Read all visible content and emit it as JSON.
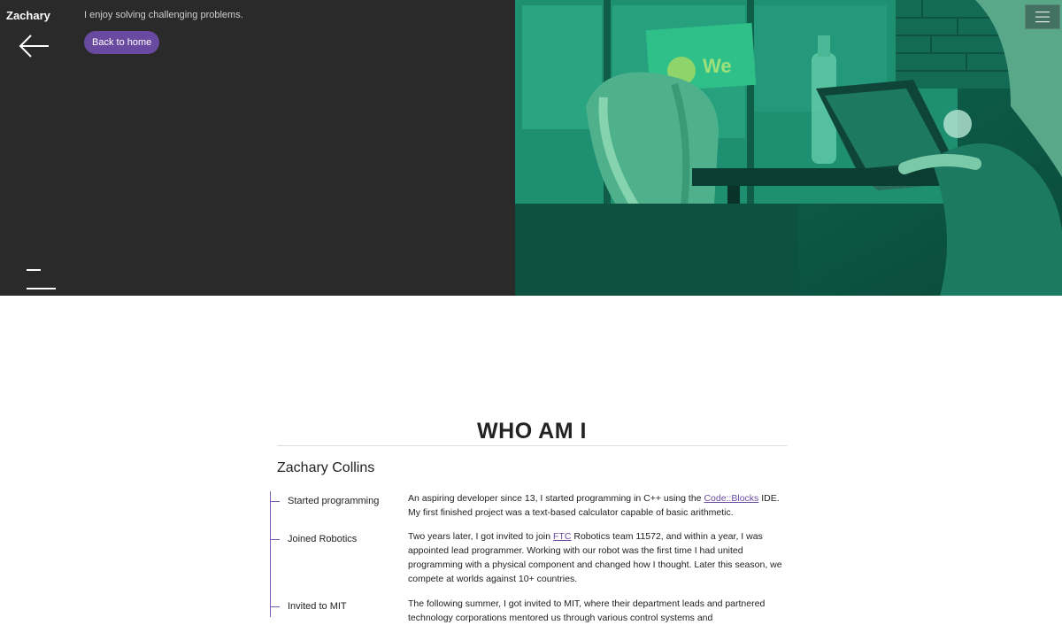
{
  "header": {
    "brand": "Zachary",
    "tagline": "I enjoy solving challenging problems.",
    "home_button": "Back to home"
  },
  "hero_image": {
    "sign_text": "We"
  },
  "about": {
    "title": "WHO AM I",
    "name": "Zachary Collins",
    "timeline": [
      {
        "label": "Started programming",
        "text_before": "An aspiring developer since 13, I started programming in C++ using the ",
        "link": "Code::Blocks",
        "text_after": " IDE. My first finished project was a text-based calculator capable of basic arithmetic."
      },
      {
        "label": "Joined Robotics",
        "text_before": "Two years later, I got invited to join ",
        "link": "FTC",
        "text_after": " Robotics team 11572, and within a year, I was appointed lead programmer. Working with our robot was the first time I had united programming with a physical component and changed how I thought. Later this season, we compete at worlds against 10+ countries."
      },
      {
        "label": "Invited to MIT",
        "text_before": "The following summer, I got invited to MIT, where their department leads and partnered technology corporations mentored us through various control systems and",
        "link": "",
        "text_after": ""
      }
    ]
  },
  "colors": {
    "hero_dark": "#2a2a2a",
    "accent_purple": "#6a4aa0",
    "hero_teal": "#0c5a48"
  }
}
